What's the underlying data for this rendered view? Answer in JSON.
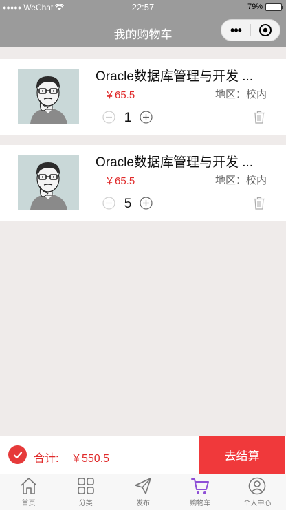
{
  "status_bar": {
    "carrier": "WeChat",
    "time": "22:57",
    "battery": "79%",
    "battery_level": 0.79
  },
  "nav": {
    "title": "我的购物车",
    "more_label": "•••"
  },
  "cart": {
    "items": [
      {
        "title": "Oracle数据库管理与开发 ...",
        "price": "￥65.5",
        "region": "地区：校内",
        "quantity": "1"
      },
      {
        "title": "Oracle数据库管理与开发 ...",
        "price": "￥65.5",
        "region": "地区：校内",
        "quantity": "5"
      }
    ]
  },
  "checkout": {
    "total_label": "合计:",
    "total_amount": "￥550.5",
    "button_label": "去结算"
  },
  "tabs": [
    {
      "label": "首页",
      "icon": "home-icon"
    },
    {
      "label": "分类",
      "icon": "grid-icon"
    },
    {
      "label": "发布",
      "icon": "send-icon"
    },
    {
      "label": "购物车",
      "icon": "cart-icon",
      "active": true
    },
    {
      "label": "个人中心",
      "icon": "user-icon"
    }
  ],
  "colors": {
    "accent_red": "#e02b2b",
    "checkout_button": "#f0393b",
    "nav_gray": "#9b9b9b",
    "tab_active": "#8e4fd6"
  }
}
